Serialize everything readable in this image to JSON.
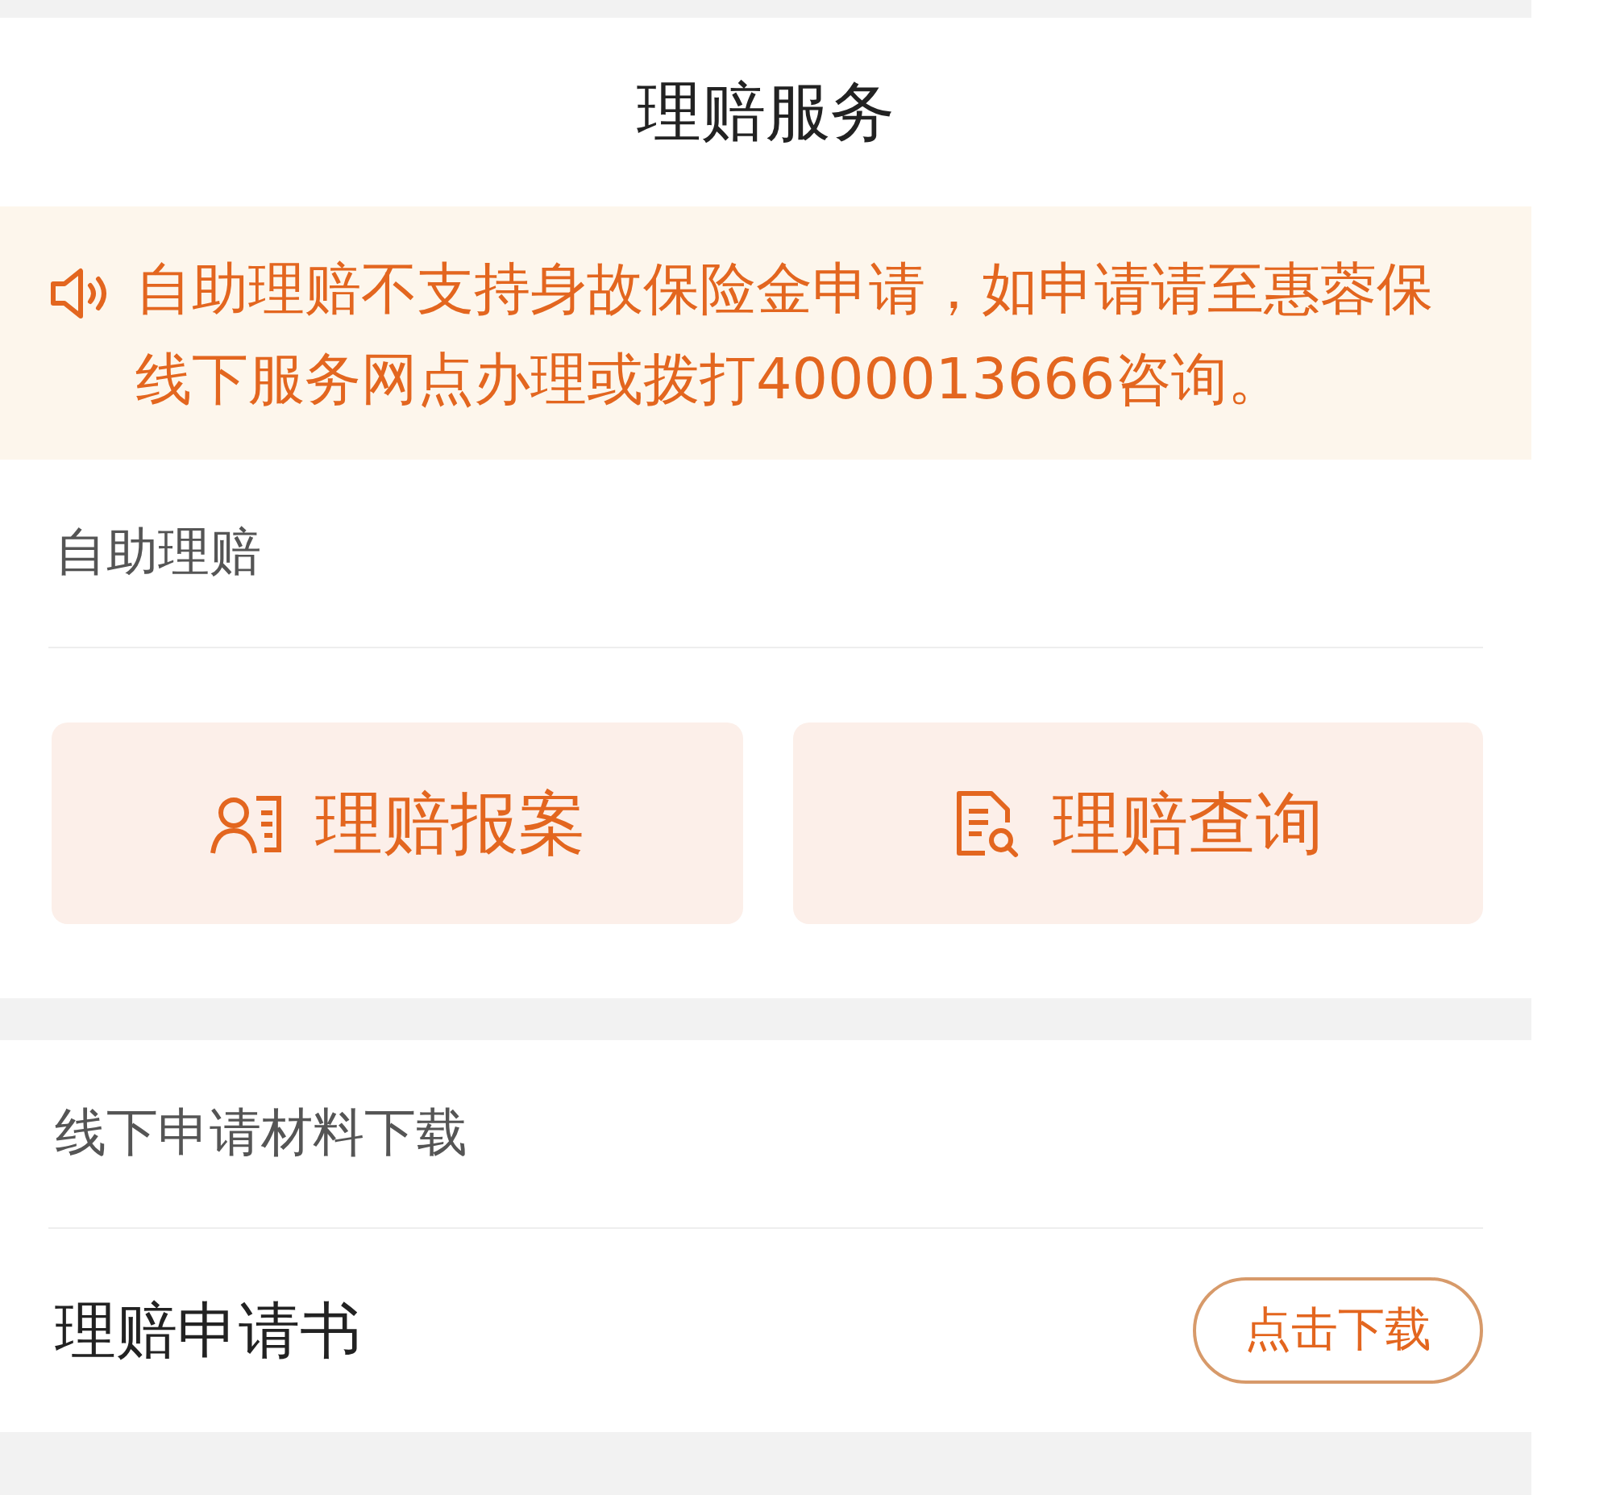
{
  "header": {
    "title": "理赔服务"
  },
  "notice": {
    "text": "自助理赔不支持身故保险金申请，如申请请至惠蓉保线下服务网点办理或拨打4000013666咨询。"
  },
  "self_service": {
    "title": "自助理赔",
    "actions": [
      {
        "kind": "report",
        "label": "理赔报案"
      },
      {
        "kind": "query",
        "label": "理赔查询"
      }
    ]
  },
  "downloads": {
    "title": "线下申请材料下载",
    "items": [
      {
        "name": "理赔申请书",
        "button": "点击下载"
      }
    ]
  }
}
